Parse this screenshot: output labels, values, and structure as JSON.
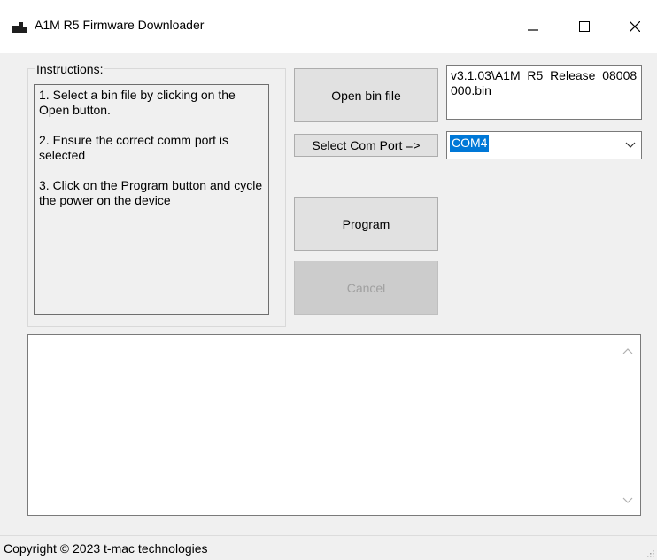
{
  "window": {
    "title": "A1M R5 Firmware Downloader"
  },
  "instructions": {
    "group_label": "Instructions:",
    "steps": [
      "1. Select a bin file by clicking on the Open button.",
      "2. Ensure the correct comm port is selected",
      "3. Click on the Program button and cycle the power on the device"
    ]
  },
  "file": {
    "open_button": "Open bin file",
    "path": "v3.1.03\\A1M_R5_Release_08008000.bin"
  },
  "com_port": {
    "label_button": "Select Com Port =>",
    "selected": "COM4"
  },
  "actions": {
    "program_button": "Program",
    "cancel_button": "Cancel",
    "cancel_enabled": false
  },
  "log": {
    "text": ""
  },
  "status_bar": {
    "text": "Copyright © 2023 t-mac technologies"
  },
  "colors": {
    "selection": "#0078d7",
    "button_face": "#e1e1e1",
    "window_bg": "#f0f0f0"
  },
  "icons": [
    "app-icon",
    "minimize-icon",
    "maximize-icon",
    "close-icon",
    "chevron-down-icon",
    "scroll-up-icon",
    "scroll-down-icon",
    "resize-grip-icon"
  ]
}
